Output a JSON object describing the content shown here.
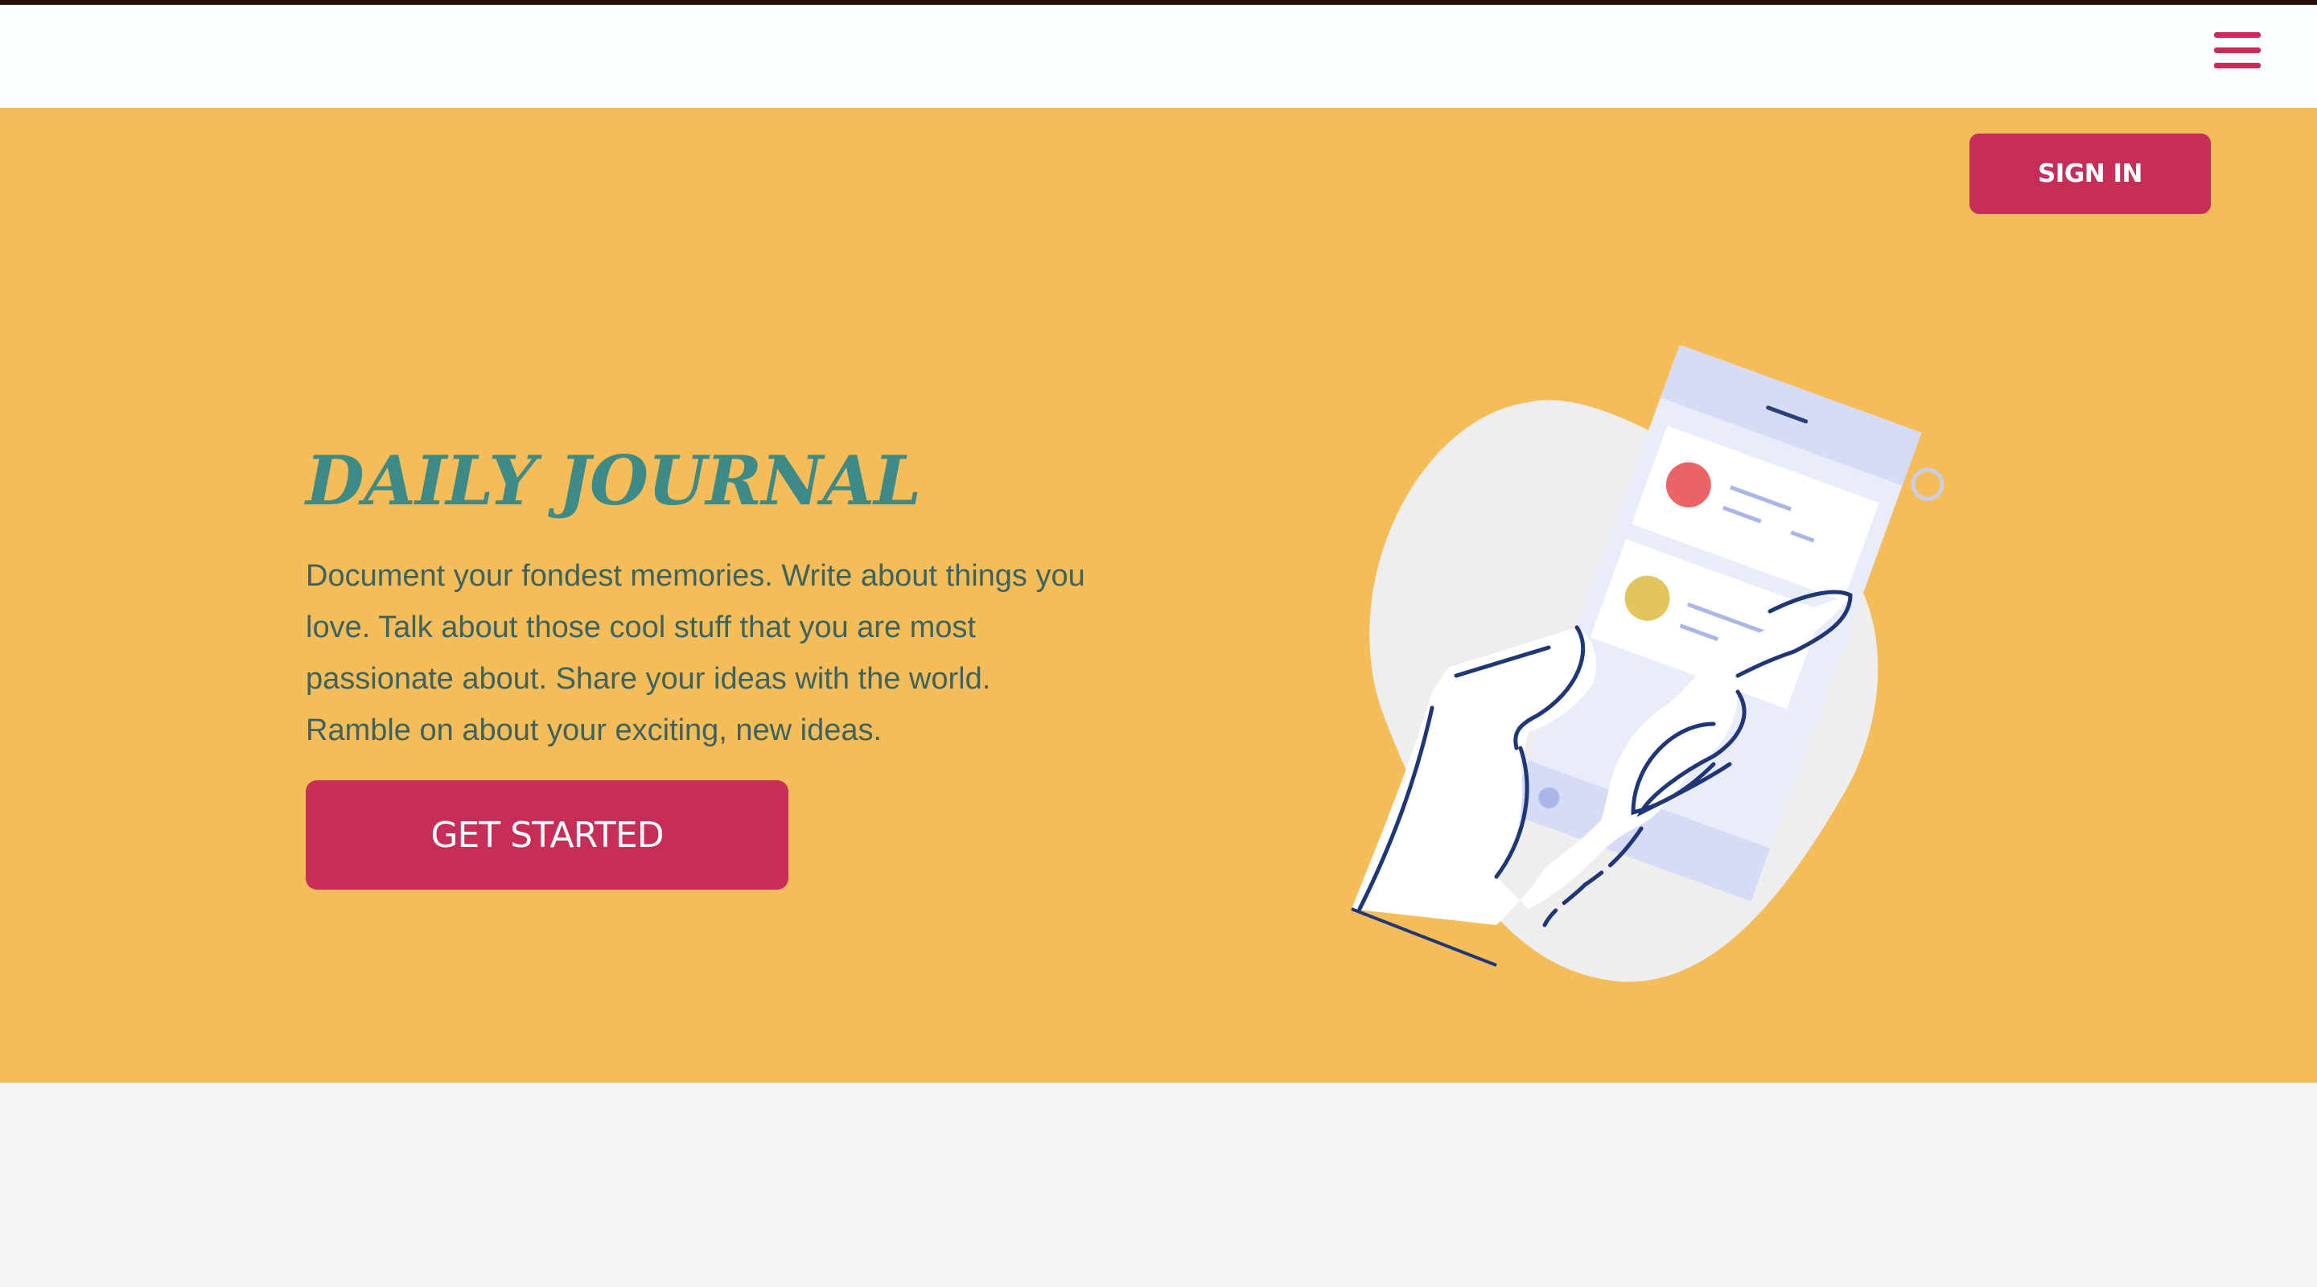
{
  "header": {
    "menu_icon": "hamburger-menu-icon",
    "accent_color": "#c62d58"
  },
  "hero": {
    "background_color": "#f4bd5a",
    "sign_in_label": "SIGN IN",
    "title": "DAILY JOURNAL",
    "title_color": "#3e8a86",
    "description": "Document your fondest memories. Write about things you love. Talk about those cool stuff that you are most passionate about. Share your ideas with the world. Ramble on about your exciting, new ideas.",
    "cta_label": "GET STARTED",
    "illustration": "hand-holding-phone-illustration"
  }
}
